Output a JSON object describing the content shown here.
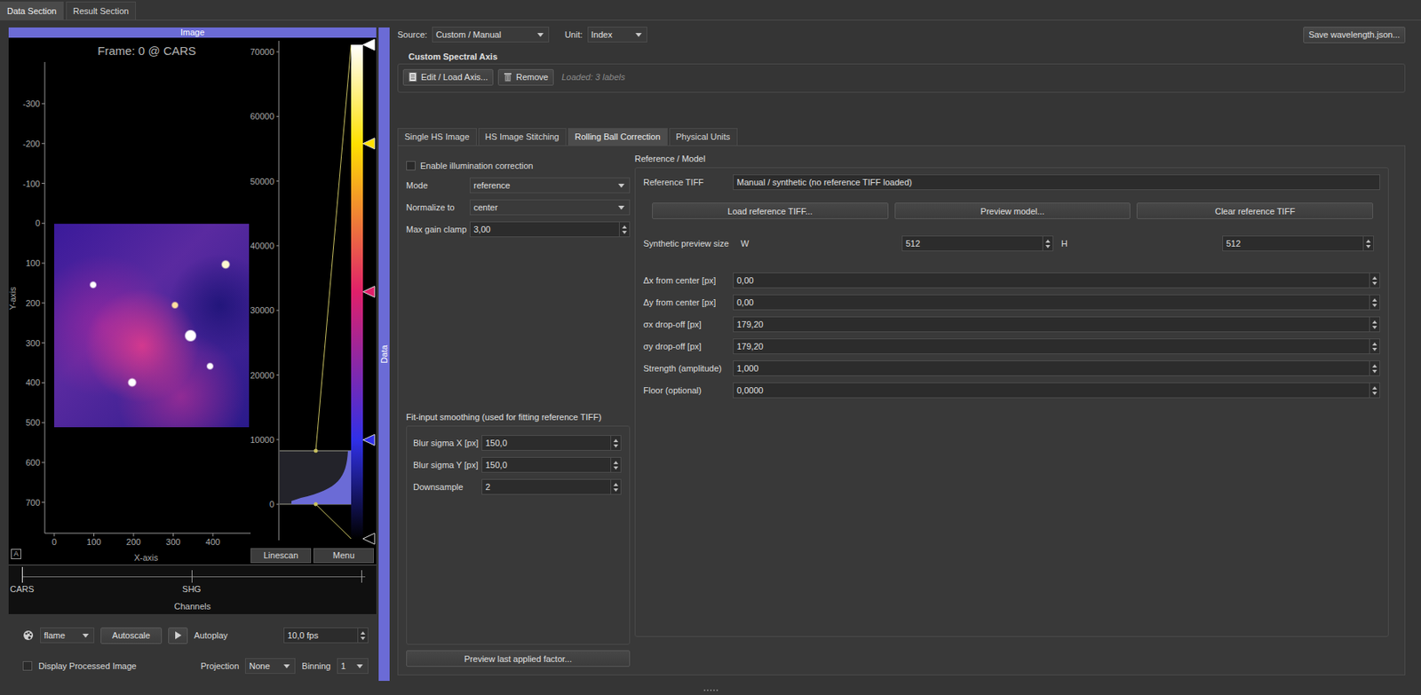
{
  "top_tabs": [
    {
      "label": "Data Section",
      "selected": true
    },
    {
      "label": "Result Section",
      "selected": false
    }
  ],
  "image_panel": {
    "title": "Image",
    "frame_label": "Frame: 0 @ CARS",
    "y_axis_label": "Y-axis",
    "x_axis_label": "X-axis",
    "y_ticks": [
      "-300",
      "-200",
      "-100",
      "0",
      "100",
      "200",
      "300",
      "400",
      "500",
      "600",
      "700"
    ],
    "x_ticks": [
      "0",
      "100",
      "200",
      "300",
      "400"
    ],
    "histogram_ticks": [
      "70000",
      "60000",
      "50000",
      "40000",
      "30000",
      "20000",
      "10000",
      "0"
    ],
    "colorbar_markers": [
      {
        "level": 1,
        "color": "#ffffff"
      },
      {
        "level": 0.8,
        "color": "#ffe000"
      },
      {
        "level": 0.5,
        "color": "#e0206a"
      },
      {
        "level": 0.2,
        "color": "#3030e8"
      },
      {
        "level": 0,
        "color": "#000000"
      }
    ],
    "corner_button": "A",
    "buttons": [
      "Linescan",
      "Menu"
    ]
  },
  "channels": {
    "label": "Channels",
    "items": [
      {
        "name": "CARS",
        "selected": true
      },
      {
        "name": "SHG",
        "selected": false
      }
    ]
  },
  "controls": {
    "colormap": "flame",
    "autoscale": "Autoscale",
    "autoplay": "Autoplay",
    "fps": "10,0 fps",
    "display_processed": {
      "label": "Display Processed Image",
      "checked": false
    },
    "projection": {
      "label": "Projection",
      "value": "None"
    },
    "binning": {
      "label": "Binning",
      "value": "1"
    }
  },
  "divider_label": "Data",
  "header": {
    "source_label": "Source:",
    "source": "Custom / Manual",
    "unit_label": "Unit:",
    "unit": "Index",
    "save_button": "Save wavelength.json..."
  },
  "spectral_axis": {
    "title": "Custom Spectral Axis",
    "edit_button": "Edit / Load Axis...",
    "remove_button": "Remove",
    "status": "Loaded: 3 labels"
  },
  "tabs": [
    {
      "label": "Single HS Image",
      "selected": false
    },
    {
      "label": "HS Image Stitching",
      "selected": false
    },
    {
      "label": "Rolling Ball Correction",
      "selected": true
    },
    {
      "label": "Physical Units",
      "selected": false
    }
  ],
  "correction": {
    "enable": {
      "label": "Enable illumination correction",
      "checked": false
    },
    "fields": [
      {
        "label": "Mode",
        "value": "reference",
        "kind": "dropdown"
      },
      {
        "label": "Normalize to",
        "value": "center",
        "kind": "dropdown"
      },
      {
        "label": "Max gain clamp",
        "value": "3,00",
        "kind": "spin"
      }
    ],
    "smoothing": {
      "title": "Fit-input smoothing (used for fitting reference TIFF)",
      "fields": [
        {
          "label": "Blur sigma X [px]",
          "value": "150,0"
        },
        {
          "label": "Blur sigma Y [px]",
          "value": "150,0"
        },
        {
          "label": "Downsample",
          "value": "2"
        }
      ]
    },
    "preview_button": "Preview last applied factor..."
  },
  "reference_model": {
    "title": "Reference / Model",
    "tiff_label": "Reference TIFF",
    "tiff_value": "Manual / synthetic (no reference TIFF loaded)",
    "buttons": [
      "Load reference TIFF...",
      "Preview model...",
      "Clear reference TIFF"
    ],
    "size_label": "Synthetic preview size",
    "width_label": "W",
    "width": "512",
    "height_label": "H",
    "height": "512",
    "params": [
      {
        "label": "Δx from center [px]",
        "value": "0,00"
      },
      {
        "label": "Δy from center [px]",
        "value": "0,00"
      },
      {
        "label": "σx drop-off [px]",
        "value": "179,20"
      },
      {
        "label": "σy drop-off [px]",
        "value": "179,20"
      },
      {
        "label": "Strength (amplitude)",
        "value": "1,000"
      },
      {
        "label": "Floor (optional)",
        "value": "0,0000"
      }
    ]
  }
}
